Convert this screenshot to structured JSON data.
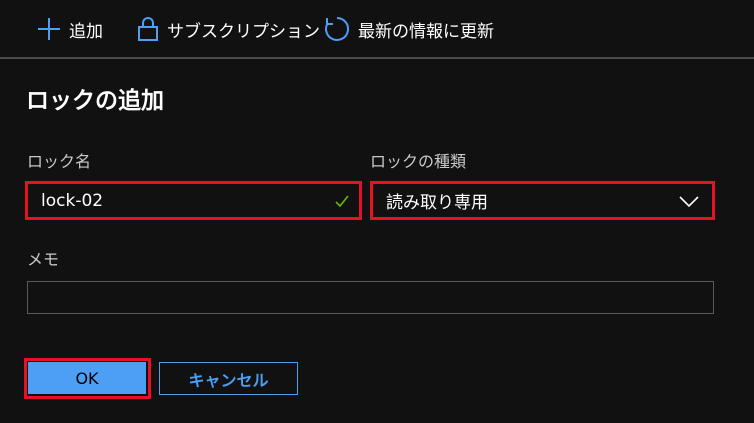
{
  "toolbar": {
    "add_label": "追加",
    "subscription_label": "サブスクリプション",
    "refresh_label": "最新の情報に更新"
  },
  "dialog": {
    "title": "ロックの追加",
    "lock_name_label": "ロック名",
    "lock_name_value": "lock-02",
    "lock_type_label": "ロックの種類",
    "lock_type_value": "読み取り専用",
    "memo_label": "メモ",
    "memo_value": "",
    "ok_label": "OK",
    "cancel_label": "キャンセル"
  },
  "colors": {
    "background": "#111111",
    "accent": "#4c9ff5",
    "highlight": "#e81123",
    "valid_check": "#6bb700"
  },
  "icons": [
    "plus-icon",
    "lock-icon",
    "refresh-icon",
    "check-icon",
    "chevron-down-icon"
  ]
}
